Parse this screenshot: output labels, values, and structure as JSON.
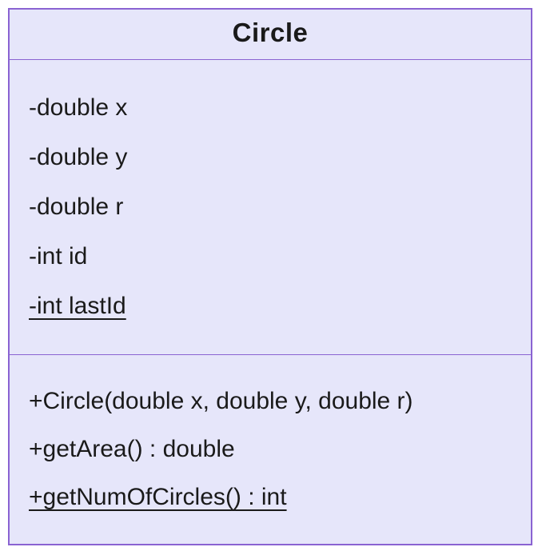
{
  "class": {
    "name": "Circle",
    "attributes": [
      {
        "text": "-double x",
        "static": false
      },
      {
        "text": "-double y",
        "static": false
      },
      {
        "text": "-double r",
        "static": false
      },
      {
        "text": "-int id",
        "static": false
      },
      {
        "text": "-int lastId",
        "static": true
      }
    ],
    "methods": [
      {
        "text": "+Circle(double x, double y, double r)",
        "static": false
      },
      {
        "text": "+getArea() : double",
        "static": false
      },
      {
        "text": "+getNumOfCircles() : int",
        "static": true
      }
    ]
  }
}
